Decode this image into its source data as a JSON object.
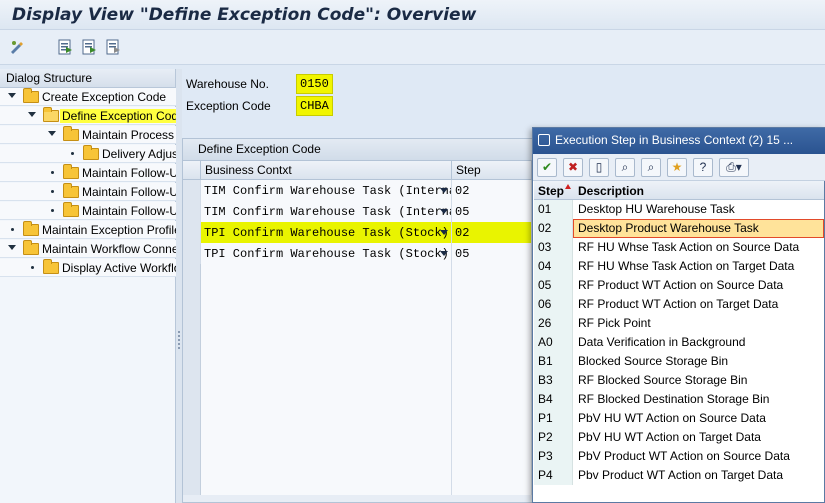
{
  "page_title": "Display View \"Define Exception Code\": Overview",
  "dialog_structure": {
    "header": "Dialog Structure",
    "items": [
      {
        "label": "Create Exception Code"
      },
      {
        "label": "Define Exception Code"
      },
      {
        "label": "Maintain Process"
      },
      {
        "label": "Delivery Adjustment"
      },
      {
        "label": "Maintain Follow-Up"
      },
      {
        "label": "Maintain Follow-Up"
      },
      {
        "label": "Maintain Follow-Up"
      },
      {
        "label": "Maintain Exception Profile"
      },
      {
        "label": "Maintain Workflow Connection"
      },
      {
        "label": "Display Active Workflow"
      }
    ]
  },
  "header_fields": {
    "warehouse_label": "Warehouse No.",
    "warehouse_value": "0150",
    "exception_label": "Exception Code",
    "exception_value": "CHBA"
  },
  "table": {
    "title": "Define Exception Code",
    "columns": [
      "Business Contxt",
      "Step"
    ],
    "rows": [
      {
        "context": "TIM Confirm Warehouse Task (Internal)",
        "step": "02"
      },
      {
        "context": "TIM Confirm Warehouse Task (Internal)",
        "step": "05"
      },
      {
        "context": "TPI Confirm Warehouse Task (Stock)",
        "step": "02"
      },
      {
        "context": "TPI Confirm Warehouse Task (Stock)",
        "step": "05"
      }
    ]
  },
  "popup": {
    "title": "Execution Step in Business Context (2)   15 ...",
    "col_step": "Step",
    "col_desc": "Description",
    "buttons": [
      "check-icon",
      "cancel-icon",
      "new-icon",
      "find-icon",
      "find-next-icon",
      "favorites-icon",
      "help-icon",
      "print-icon"
    ],
    "rows": [
      {
        "step": "01",
        "desc": "Desktop HU Warehouse Task"
      },
      {
        "step": "02",
        "desc": "Desktop Product Warehouse Task"
      },
      {
        "step": "03",
        "desc": "RF HU Whse Task Action on Source Data"
      },
      {
        "step": "04",
        "desc": "RF HU Whse Task Action on Target Data"
      },
      {
        "step": "05",
        "desc": "RF Product WT Action on Source Data"
      },
      {
        "step": "06",
        "desc": "RF Product WT Action on Target Data"
      },
      {
        "step": "26",
        "desc": "RF Pick Point"
      },
      {
        "step": "A0",
        "desc": "Data Verification in Background"
      },
      {
        "step": "B1",
        "desc": "Blocked Source Storage Bin"
      },
      {
        "step": "B3",
        "desc": "RF Blocked Source Storage Bin"
      },
      {
        "step": "B4",
        "desc": "RF Blocked Destination Storage Bin"
      },
      {
        "step": "P1",
        "desc": "PbV HU WT Action on Source Data"
      },
      {
        "step": "P2",
        "desc": "PbV HU WT Action on Target Data"
      },
      {
        "step": "P3",
        "desc": "PbV Product WT Action on Source Data"
      },
      {
        "step": "P4",
        "desc": "Pbv Product WT Action on Target Data"
      }
    ]
  }
}
